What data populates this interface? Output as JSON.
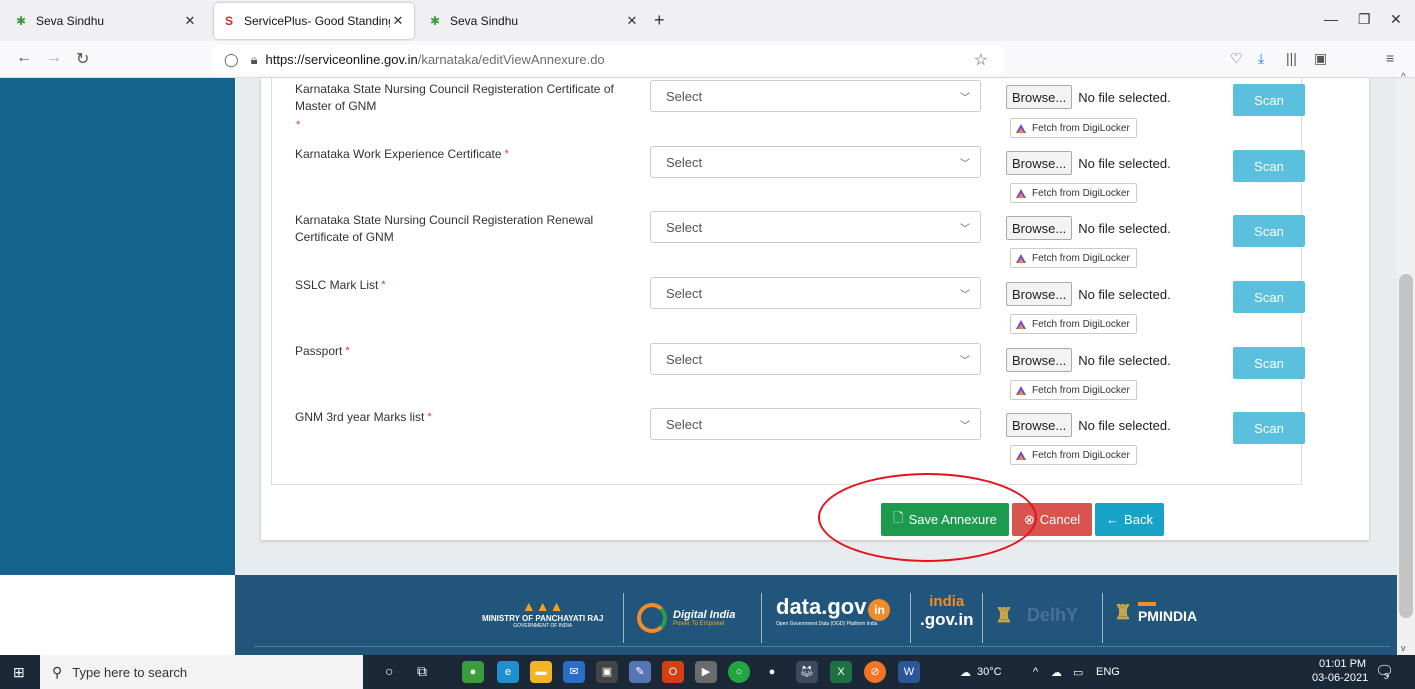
{
  "browser": {
    "tabs": [
      {
        "title": "Seva Sindhu",
        "active": false
      },
      {
        "title": "ServicePlus- Good Standing for",
        "active": true
      },
      {
        "title": "Seva Sindhu",
        "active": false
      }
    ],
    "url_host": "https://serviceonline.gov.in",
    "url_path": "/karnataka/editViewAnnexure.do"
  },
  "annexure": {
    "rows": [
      {
        "label": "Karnataka State Nursing Council Registeration Certificate of Master of GNM",
        "required": true,
        "select_value": "Select",
        "browse_label": "Browse...",
        "file_status": "No file selected.",
        "digilocker_label": "Fetch from DigiLocker",
        "scan_label": "Scan"
      },
      {
        "label": "Karnataka Work Experience Certificate",
        "required": true,
        "select_value": "Select",
        "browse_label": "Browse...",
        "file_status": "No file selected.",
        "digilocker_label": "Fetch from DigiLocker",
        "scan_label": "Scan"
      },
      {
        "label": "Karnataka State Nursing Council Registeration Renewal Certificate of GNM",
        "required": false,
        "select_value": "Select",
        "browse_label": "Browse...",
        "file_status": "No file selected.",
        "digilocker_label": "Fetch from DigiLocker",
        "scan_label": "Scan"
      },
      {
        "label": "SSLC Mark List",
        "required": true,
        "select_value": "Select",
        "browse_label": "Browse...",
        "file_status": "No file selected.",
        "digilocker_label": "Fetch from DigiLocker",
        "scan_label": "Scan"
      },
      {
        "label": "Passport",
        "required": true,
        "select_value": "Select",
        "browse_label": "Browse...",
        "file_status": "No file selected.",
        "digilocker_label": "Fetch from DigiLocker",
        "scan_label": "Scan"
      },
      {
        "label": "GNM 3rd year Marks list",
        "required": true,
        "select_value": "Select",
        "browse_label": "Browse...",
        "file_status": "No file selected.",
        "digilocker_label": "Fetch from DigiLocker",
        "scan_label": "Scan"
      }
    ],
    "required_marker": "*",
    "buttons": {
      "save": "Save Annexure",
      "cancel": "Cancel",
      "back": "Back"
    }
  },
  "footer": {
    "logos": [
      {
        "name": "panchayati-raj",
        "text": "MINISTRY OF PANCHAYATI RAJ",
        "subtext": "GOVERNMENT OF INDIA"
      },
      {
        "name": "digital-india",
        "text": "Digital India",
        "subtext": "Power To Empower"
      },
      {
        "name": "data-gov",
        "text": "data.gov",
        "badge": "in",
        "subtext": "Open Government Data (OGD) Platform India"
      },
      {
        "name": "india-gov",
        "text": "india",
        "subtext": ".gov.in"
      },
      {
        "name": "digiy",
        "text": "DelhY"
      },
      {
        "name": "pmindia",
        "text": "PMINDIA"
      }
    ]
  },
  "taskbar": {
    "search_placeholder": "Type here to search",
    "weather": "30°C",
    "language": "ENG",
    "time": "01:01 PM",
    "date": "03-06-2021",
    "notifications": "3"
  },
  "colors": {
    "sidebar": "#14638c",
    "footer": "#21557c",
    "scan": "#5bc0de",
    "save": "#1c9b4f",
    "cancel": "#d9534f",
    "back": "#17a2c8",
    "annotation_circle": "#e5121b"
  }
}
